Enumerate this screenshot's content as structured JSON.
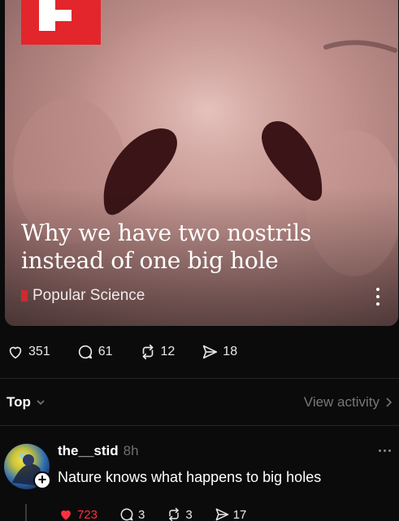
{
  "post": {
    "source_logo_icon": "flipboard-logo-icon",
    "title": "Why we have two nostrils instead of one big hole",
    "title_line1": "Why we have two nostrils",
    "title_line2": "instead of one big hole",
    "source_name": "Popular Science",
    "brand_color": "#e3262b"
  },
  "stats": {
    "likes": "351",
    "replies": "61",
    "reposts": "12",
    "shares": "18"
  },
  "thread_controls": {
    "sort_label": "Top",
    "view_activity_label": "View activity"
  },
  "reply": {
    "username": "the__stid",
    "time": "8h",
    "text": "Nature knows what happens to big holes",
    "likes": "723",
    "replies": "3",
    "reposts": "3",
    "shares": "17",
    "like_color": "#ff3040"
  }
}
